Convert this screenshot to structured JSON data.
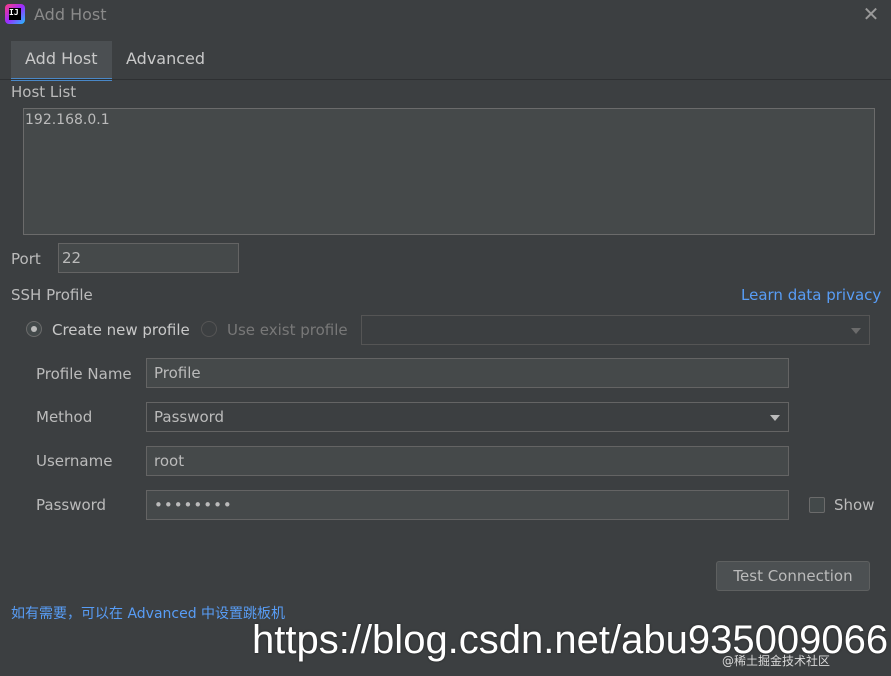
{
  "window": {
    "title": "Add Host",
    "app_icon_text": "IJ"
  },
  "tabs": [
    {
      "label": "Add Host",
      "active": true
    },
    {
      "label": "Advanced",
      "active": false
    }
  ],
  "host_list": {
    "label": "Host List",
    "value": "192.168.0.1"
  },
  "port": {
    "label": "Port",
    "value": "22"
  },
  "ssh_profile": {
    "label": "SSH Profile",
    "privacy_link": "Learn data privacy",
    "radio_new": "Create new profile",
    "radio_exist": "Use exist profile",
    "selected": "new",
    "existing_profile_value": ""
  },
  "form": {
    "profile_name_label": "Profile Name",
    "profile_name_value": "Profile",
    "method_label": "Method",
    "method_value": "Password",
    "username_label": "Username",
    "username_value": "root",
    "password_label": "Password",
    "password_value": "••••••••",
    "show_label": "Show"
  },
  "buttons": {
    "test_connection": "Test Connection"
  },
  "hint": "如有需要，可以在 Advanced 中设置跳板机",
  "watermark": {
    "url": "https://blog.csdn.net/abu935009066",
    "sub": "@稀土掘金技术社区"
  },
  "colors": {
    "background": "#3c3f41",
    "accent": "#4a88c7",
    "link": "#589df6"
  }
}
